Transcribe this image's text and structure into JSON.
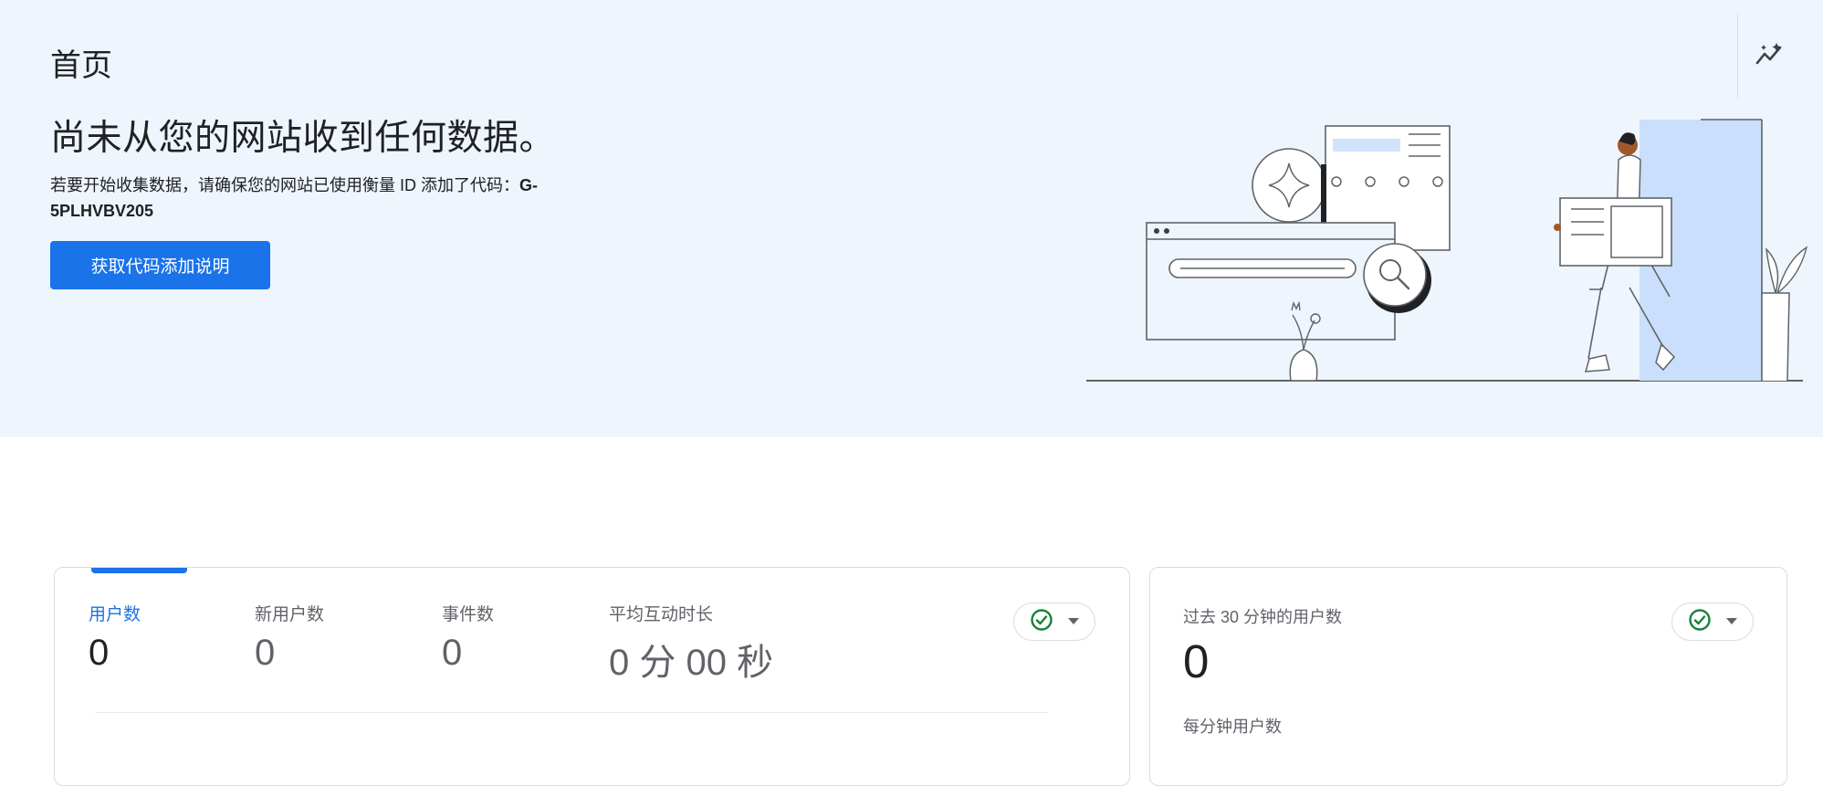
{
  "header": {
    "title": "首页"
  },
  "hero": {
    "headline": "尚未从您的网站收到任何数据。",
    "instruction": "若要开始收集数据，请确保您的网站已使用衡量 ID 添加了代码：",
    "measurement_id": "G-5PLHVBV205",
    "cta_label": "获取代码添加说明"
  },
  "overview_card": {
    "metrics": [
      {
        "label": "用户数",
        "value": "0"
      },
      {
        "label": "新用户数",
        "value": "0"
      },
      {
        "label": "事件数",
        "value": "0"
      },
      {
        "label": "平均互动时长",
        "value": "0 分 00 秒"
      }
    ]
  },
  "realtime_card": {
    "title": "过去 30 分钟的用户数",
    "value": "0",
    "subtitle": "每分钟用户数"
  },
  "colors": {
    "accent": "#1a73e8",
    "status_ok": "#188038",
    "hero_bg": "#eef5fd"
  },
  "icons": {
    "insights": "insights-icon",
    "status": "check-circle-icon",
    "dropdown": "caret-down-icon"
  }
}
